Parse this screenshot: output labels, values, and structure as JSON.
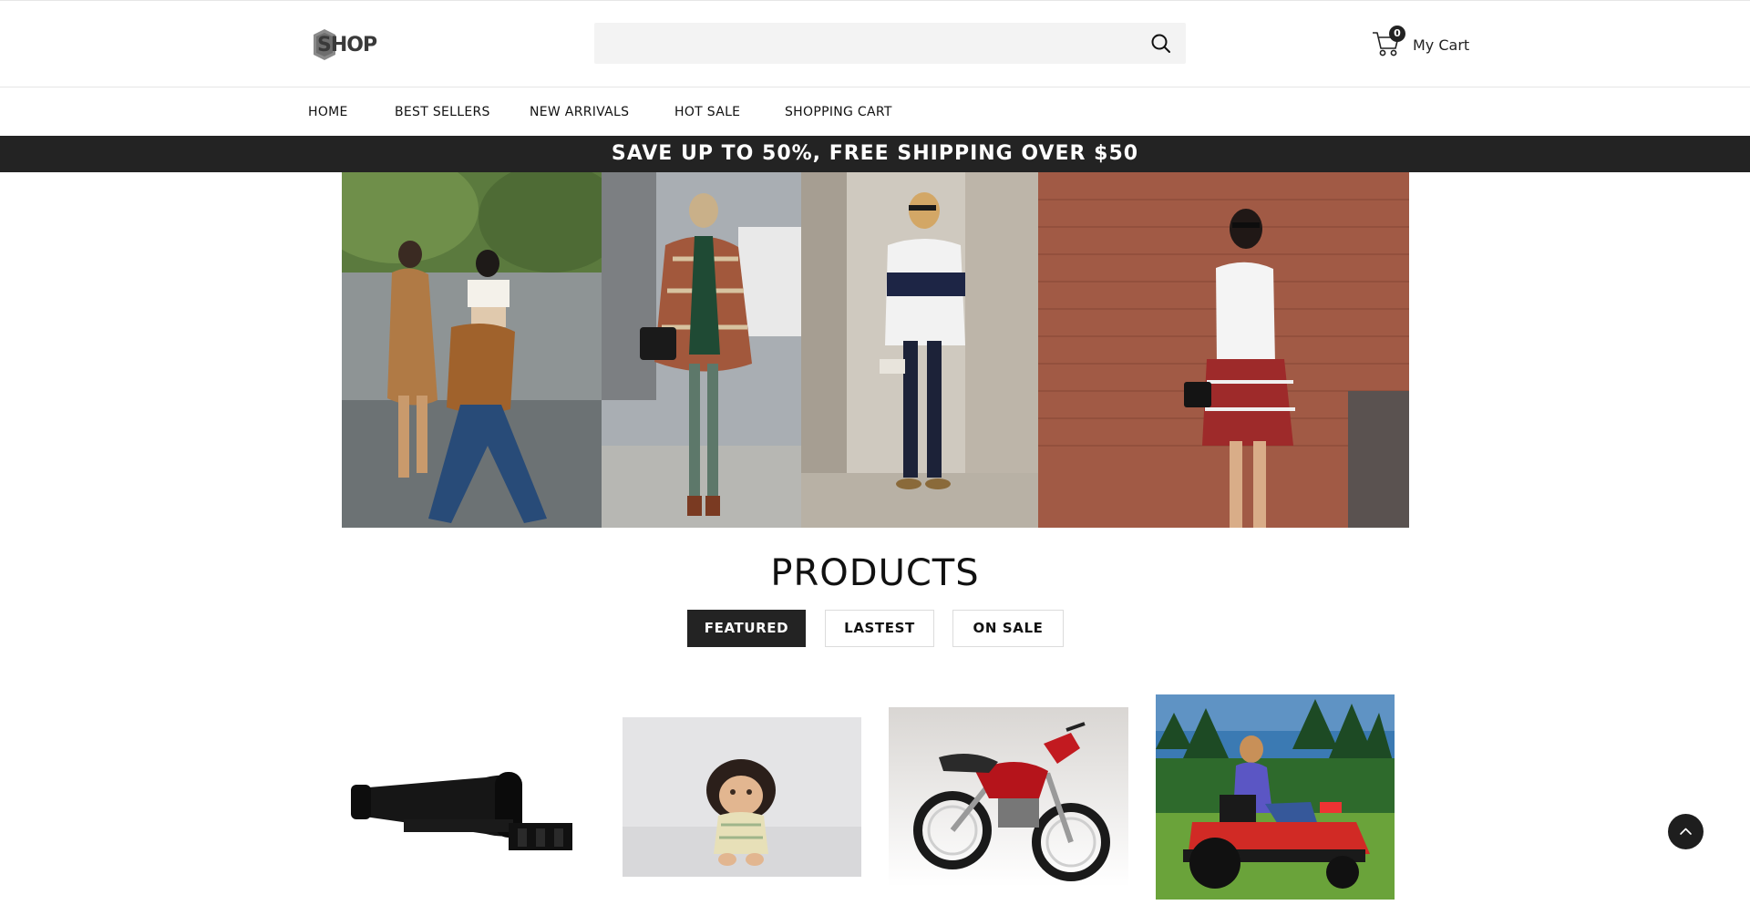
{
  "header": {
    "logo_text": "SHOP",
    "search": {
      "placeholder": "",
      "value": "",
      "icon": "search-icon"
    },
    "cart": {
      "count": "0",
      "label": "My Cart",
      "icon": "cart-icon"
    }
  },
  "nav": {
    "items": [
      {
        "label": "HOME"
      },
      {
        "label": "BEST SELLERS"
      },
      {
        "label": "NEW ARRIVALS"
      },
      {
        "label": "HOT SALE"
      },
      {
        "label": "SHOPPING CART"
      }
    ]
  },
  "promo": {
    "text": "SAVE UP TO 50%, FREE SHIPPING OVER $50"
  },
  "hero": {
    "panels": [
      {
        "subject": "two women walking on street"
      },
      {
        "subject": "woman in plaid poncho and green scarf"
      },
      {
        "subject": "woman in navy and white top with sunglasses"
      },
      {
        "subject": "woman with plaid shirt around waist against brick wall"
      }
    ]
  },
  "products_section": {
    "title": "PRODUCTS",
    "tabs": [
      {
        "label": "FEATURED",
        "active": true
      },
      {
        "label": "LASTEST",
        "active": false
      },
      {
        "label": "ON SALE",
        "active": false
      }
    ],
    "items": [
      {
        "subject": "rifle scope"
      },
      {
        "subject": "doll"
      },
      {
        "subject": "red motorcycle"
      },
      {
        "subject": "riding lawn mower"
      }
    ]
  },
  "back_to_top": {
    "icon": "chevron-up-icon"
  },
  "colors": {
    "promo_bg": "#232323",
    "active_tab_bg": "#232323",
    "search_bg": "#f3f3f3"
  }
}
